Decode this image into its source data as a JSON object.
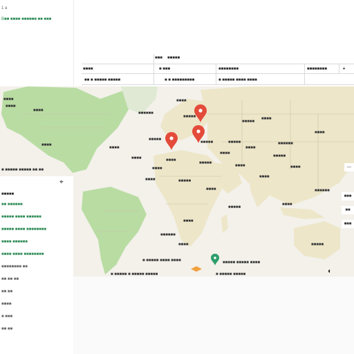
{
  "left_header": {
    "line1": "1 a",
    "line2": "B■■ ■■■■ ■■■■■■ ■■ ■■■"
  },
  "table": {
    "row1": {
      "c1": "■■■",
      "c2": "■■■■■"
    },
    "row2": {
      "c1": "■■■■",
      "c2": "■ ■■■",
      "c3": "■■■■■■■■",
      "c4": "■■■■■■■■"
    },
    "row3": {
      "c1": "■■ ■ ■■■■■ ■■■■■",
      "c2": "■ ■ ■■■■■■■■■",
      "c3": "■ ■■■■■ ■■■■ ■■■■"
    }
  },
  "map": {
    "labels": [
      "■■■■",
      "■■■■",
      "■■■■■■",
      "■■■■",
      "■■■■",
      "■■■■",
      "■■■■■",
      "■■■■",
      "■■■■",
      "■■■■■",
      "■■■■■",
      "■■■■",
      "■■■■■",
      "■■■■",
      "■■■■■",
      "■■■■■",
      "■■■■",
      "■■■■",
      "■■■■■",
      "■■■■",
      "■■■■",
      "■■■■",
      "■■■■■",
      "■■■■",
      "■■■■■■",
      "■■■■",
      "■■■■",
      "■■■■■",
      "■■■■■■",
      "■■■■",
      "■■■■■■",
      "■■■■■",
      "■■■■",
      "■■■■",
      "■■■■"
    ],
    "bottom_caption_left": "■ ■■■■■ ■ ■■■■■ ■■■■■",
    "bottom_caption_right": "■■■■■ ■■■■■ ■■■■",
    "bottom_caption_mid": "■ ■■■■■ ■■■■ ■■■■",
    "bottom_caption_mid2": "■ ■■■■■ ■■■■■",
    "pin_colors": [
      "#e44b3a",
      "#e44b3a",
      "#e44b3a",
      "#2e9e6b"
    ],
    "left_caption": "■ ■■■■■ ■■■■■ ■■ ■■",
    "ocean_color": "#f3f1ea",
    "land_green": "#b9dca3",
    "land_beige": "#ede6c9"
  },
  "legend": {
    "title": "■■■■■",
    "items": [
      "■■ ■■■■■■",
      "■■■■■ ■■■■ ■■■■■■",
      "■■■■■ ■■■■ ■■■■■■■■",
      "■■■■ ■■■■■■",
      "■■■■ ■■■■ ■■■■■■■■",
      "■■■■■■■■ ■■",
      "■■ ■■ ■■",
      "■■ ■■",
      "■■■■",
      "■ ■■■",
      "■■ ■■"
    ]
  },
  "right_chips": [
    "■■■",
    "■■",
    "■■■"
  ]
}
